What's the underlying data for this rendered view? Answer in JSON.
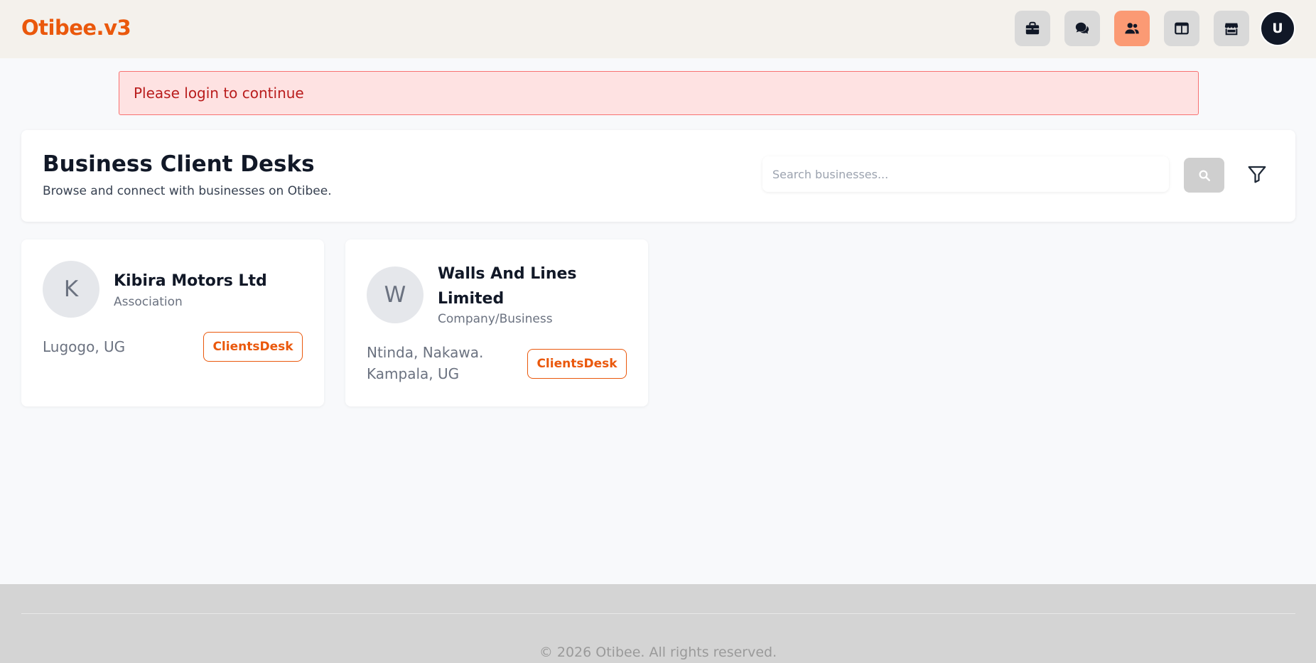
{
  "header": {
    "brand": "Otibee.v3",
    "nav": [
      {
        "icon": "briefcase-icon",
        "active": false
      },
      {
        "icon": "chat-icon",
        "active": false
      },
      {
        "icon": "users-icon",
        "active": true
      },
      {
        "icon": "columns-icon",
        "active": false
      },
      {
        "icon": "store-icon",
        "active": false
      }
    ],
    "avatar_letter": "U"
  },
  "alert": {
    "text": "Please login to continue"
  },
  "hero": {
    "title": "Business Client Desks",
    "subtitle": "Browse and connect with businesses on Otibee.",
    "search_placeholder": "Search businesses...",
    "search_value": ""
  },
  "businesses": [
    {
      "initial": "K",
      "name": "Kibira Motors Ltd",
      "type": "Association",
      "location": "Lugogo, UG",
      "button": "ClientsDesk"
    },
    {
      "initial": "W",
      "name": "Walls And Lines Limited",
      "name_line1": "Walls And Lines",
      "name_line2": "Limited",
      "type": "Company/Business",
      "location_line1": "Ntinda, Nakawa.",
      "location_line2": "Kampala, UG",
      "button": "ClientsDesk"
    }
  ],
  "footer": {
    "copyright": "© 2026 Otibee. All rights reserved."
  },
  "colors": {
    "brand": "#ea580c",
    "active_nav": "#fb9a74",
    "alert_bg": "#fee2e2",
    "alert_text": "#b91c1c"
  }
}
